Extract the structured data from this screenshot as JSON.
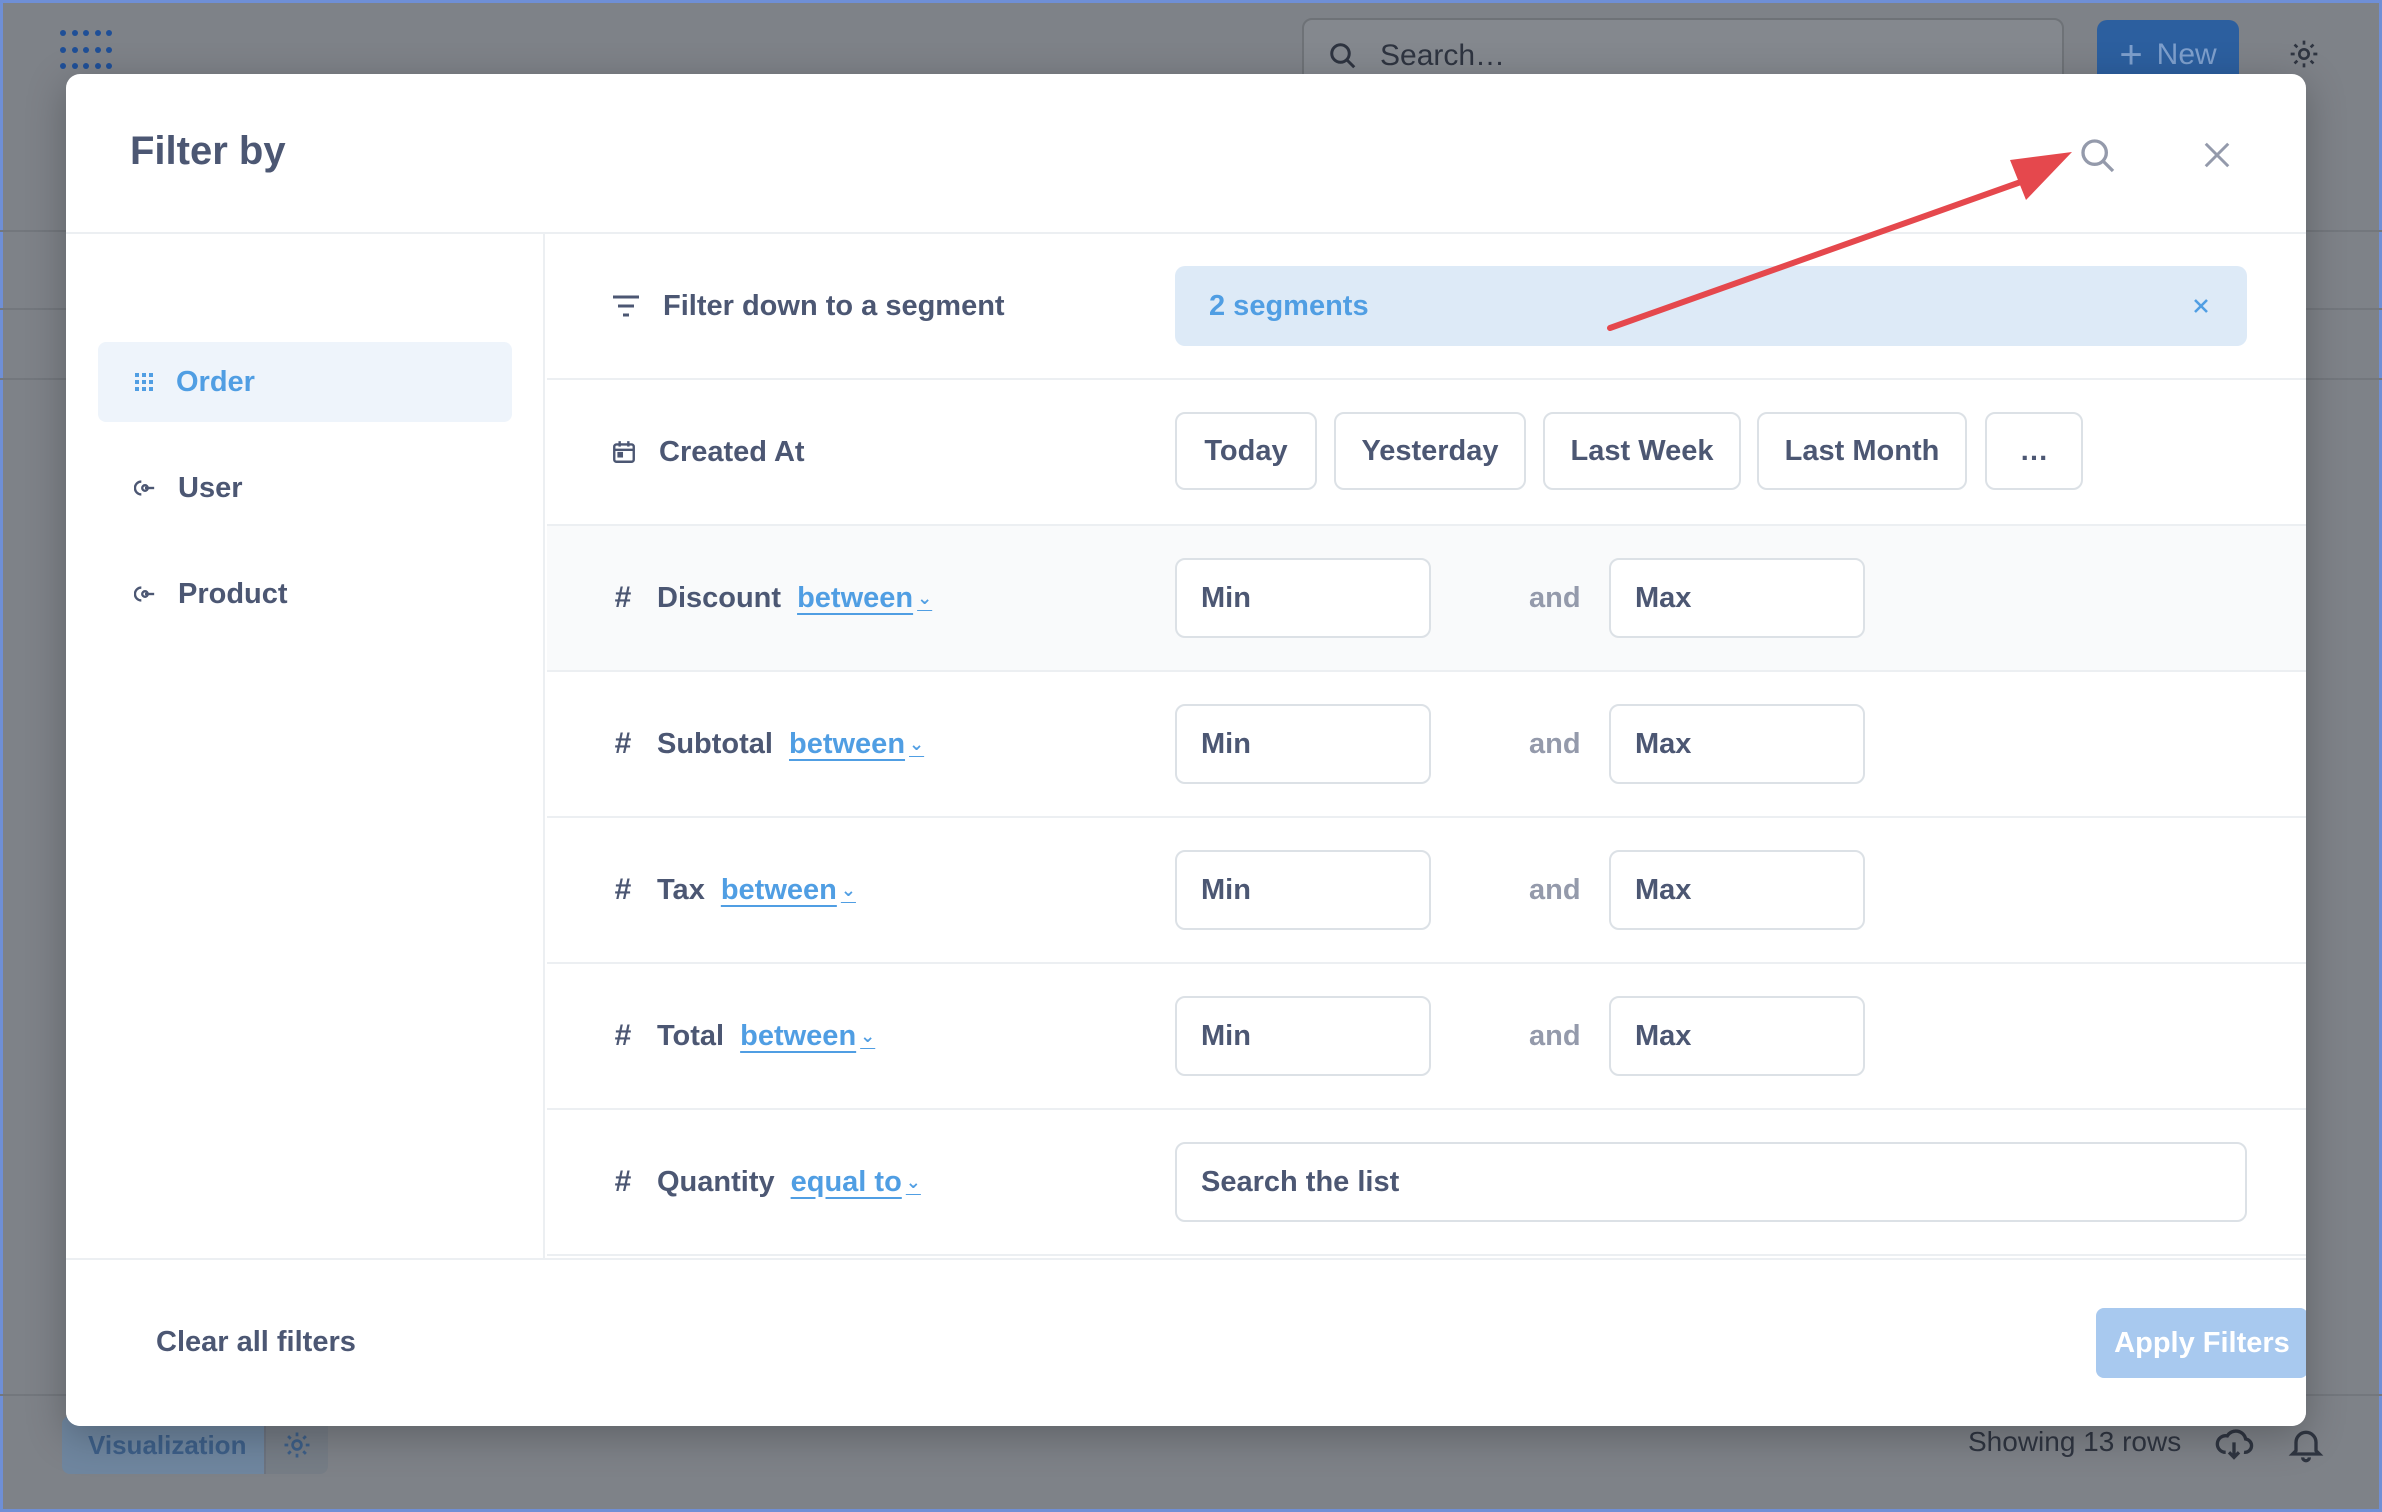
{
  "background": {
    "search_placeholder": "Search…",
    "new_button": "New",
    "visualization_button": "Visualization",
    "row_count": "Showing 13 rows"
  },
  "modal": {
    "title": "Filter by",
    "sidebar": {
      "items": [
        {
          "label": "Order",
          "icon": "grid-icon",
          "active": true
        },
        {
          "label": "User",
          "icon": "link-icon",
          "active": false
        },
        {
          "label": "Product",
          "icon": "link-icon",
          "active": false
        }
      ]
    },
    "segment": {
      "label": "Filter down to a segment",
      "value": "2 segments"
    },
    "created_at": {
      "label": "Created At",
      "shortcuts": [
        "Today",
        "Yesterday",
        "Last Week",
        "Last Month",
        "…"
      ]
    },
    "numeric_fields": [
      {
        "label": "Discount",
        "operator": "between",
        "min_placeholder": "Min",
        "max_placeholder": "Max",
        "and": "and"
      },
      {
        "label": "Subtotal",
        "operator": "between",
        "min_placeholder": "Min",
        "max_placeholder": "Max",
        "and": "and"
      },
      {
        "label": "Tax",
        "operator": "between",
        "min_placeholder": "Min",
        "max_placeholder": "Max",
        "and": "and"
      },
      {
        "label": "Total",
        "operator": "between",
        "min_placeholder": "Min",
        "max_placeholder": "Max",
        "and": "and"
      }
    ],
    "quantity": {
      "label": "Quantity",
      "operator": "equal to",
      "placeholder": "Search the list"
    },
    "footer": {
      "clear_label": "Clear all filters",
      "apply_label": "Apply Filters"
    }
  },
  "colors": {
    "brand": "#509ee3",
    "annotation_arrow": "#e5484d",
    "apply_disabled": "#a8c9ef"
  }
}
